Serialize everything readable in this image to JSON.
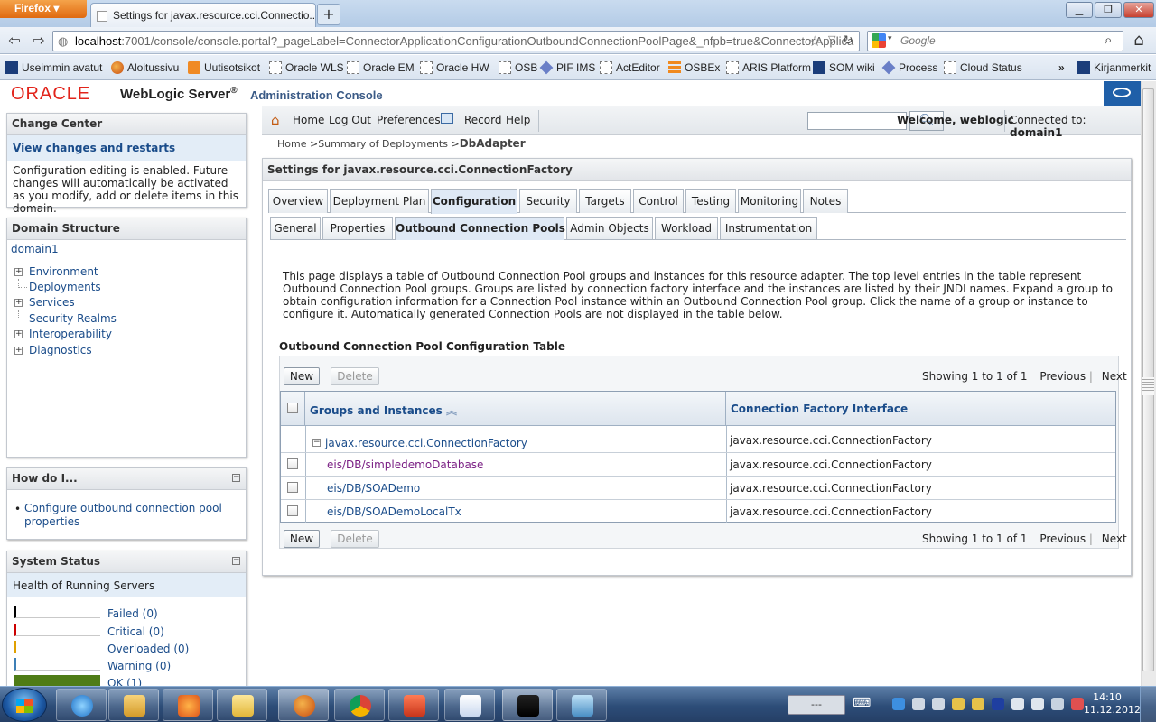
{
  "browser": {
    "menu_button": "Firefox",
    "tab_title": "Settings for javax.resource.cci.Connectio...",
    "new_tab": "+",
    "url_host": "localhost",
    "url_rest": ":7001/console/console.portal?_pageLabel=ConnectorApplicationConfigurationOutboundConnectionPoolPage&_nfpb=true&ConnectorApplica",
    "search_placeholder": "Google",
    "bookmarks_overflow": "»",
    "bookmarks_label": "Kirjanmerkit",
    "bookmarks": [
      {
        "label": "Useimmin avatut",
        "icon": "star-page"
      },
      {
        "label": "Aloitussivu",
        "icon": "firefox"
      },
      {
        "label": "Uutisotsikot",
        "icon": "rss"
      },
      {
        "label": "Oracle WLS",
        "icon": "page"
      },
      {
        "label": "Oracle EM",
        "icon": "page"
      },
      {
        "label": "Oracle HW",
        "icon": "page"
      },
      {
        "label": "OSB",
        "icon": "page"
      },
      {
        "label": "PIF IMS",
        "icon": "gear"
      },
      {
        "label": "ActEditor",
        "icon": "page"
      },
      {
        "label": "OSBEx",
        "icon": "bars"
      },
      {
        "label": "ARIS Platform",
        "icon": "page"
      },
      {
        "label": "SOM wiki",
        "icon": "star-square"
      },
      {
        "label": "Process",
        "icon": "diamond"
      },
      {
        "label": "Cloud Status",
        "icon": "page"
      }
    ]
  },
  "header": {
    "logo": "ORACLE",
    "product": "WebLogic Server",
    "product_reg": "®",
    "subtitle": "Administration Console"
  },
  "change_center": {
    "title": "Change Center",
    "link": "View changes and restarts",
    "text": "Configuration editing is enabled. Future changes will automatically be activated as you modify, add or delete items in this domain."
  },
  "domain_structure": {
    "title": "Domain Structure",
    "root": "domain1",
    "items": [
      {
        "label": "Environment",
        "expandable": true
      },
      {
        "label": "Deployments",
        "expandable": false
      },
      {
        "label": "Services",
        "expandable": true
      },
      {
        "label": "Security Realms",
        "expandable": false
      },
      {
        "label": "Interoperability",
        "expandable": true
      },
      {
        "label": "Diagnostics",
        "expandable": true
      }
    ]
  },
  "how_do_i": {
    "title": "How do I...",
    "minimize": "−",
    "links": [
      "Configure outbound connection pool properties"
    ]
  },
  "system_status": {
    "title": "System Status",
    "minimize": "−",
    "subtitle": "Health of Running Servers",
    "rows": [
      {
        "label": "Failed (0)",
        "color": "#000000"
      },
      {
        "label": "Critical (0)",
        "color": "#cc0000"
      },
      {
        "label": "Overloaded (0)",
        "color": "#e0a000"
      },
      {
        "label": "Warning (0)",
        "color": "#3d7fb6"
      },
      {
        "label": "OK (1)",
        "color": "#4f7c16"
      }
    ]
  },
  "toolbar": {
    "home": "Home",
    "logout": "Log Out",
    "preferences": "Preferences",
    "record": "Record",
    "help": "Help",
    "search_value": "",
    "welcome_prefix": "Welcome, ",
    "welcome_user": "weblogic",
    "connected_prefix": "Connected to: ",
    "connected_domain": "domain1"
  },
  "breadcrumb": {
    "home": "Home",
    "sep": ">",
    "summary": "Summary of Deployments",
    "current": "DbAdapter"
  },
  "main": {
    "title": "Settings for javax.resource.cci.ConnectionFactory",
    "tabs": [
      "Overview",
      "Deployment Plan",
      "Configuration",
      "Security",
      "Targets",
      "Control",
      "Testing",
      "Monitoring",
      "Notes"
    ],
    "selected_tab": "Configuration",
    "subtabs": [
      "General",
      "Properties",
      "Outbound Connection Pools",
      "Admin Objects",
      "Workload",
      "Instrumentation"
    ],
    "selected_subtab": "Outbound Connection Pools",
    "description": "This page displays a table of Outbound Connection Pool groups and instances for this resource adapter. The top level entries in the table represent Outbound Connection Pool groups. Groups are listed by connection factory interface and the instances are listed by their JNDI names. Expand a group to obtain configuration information for a Connection Pool instance within an Outbound Connection Pool group. Click the name of a group or instance to configure it. Automatically generated Connection Pools are not displayed in the table below.",
    "table_title": "Outbound Connection Pool Configuration Table",
    "new_button": "New",
    "delete_button": "Delete",
    "pager_showing": "Showing 1 to 1 of 1",
    "pager_previous": "Previous",
    "pager_sep": "|",
    "pager_next": "Next",
    "columns": [
      "Groups and Instances",
      "Connection Factory Interface"
    ],
    "group": {
      "name": "javax.resource.cci.ConnectionFactory",
      "interface": "javax.resource.cci.ConnectionFactory"
    },
    "rows": [
      {
        "name": "eis/DB/simpledemoDatabase",
        "interface": "javax.resource.cci.ConnectionFactory",
        "visited": true
      },
      {
        "name": "eis/DB/SOADemo",
        "interface": "javax.resource.cci.ConnectionFactory",
        "visited": false
      },
      {
        "name": "eis/DB/SOADemoLocalTx",
        "interface": "javax.resource.cci.ConnectionFactory",
        "visited": false
      }
    ]
  },
  "taskbar": {
    "time": "14:10",
    "date": "11.12.2012",
    "keyboard_indicator": "---",
    "apps": [
      "internet-explorer",
      "file-explorer",
      "media-player",
      "mail",
      "firefox",
      "chrome",
      "presentation",
      "word",
      "command-prompt",
      "image-viewer"
    ]
  },
  "colors": {
    "oracle_red": "#e2241b",
    "link": "#1a4c8a",
    "visited_link": "#7a1f84",
    "ok_green": "#4f7c16"
  }
}
